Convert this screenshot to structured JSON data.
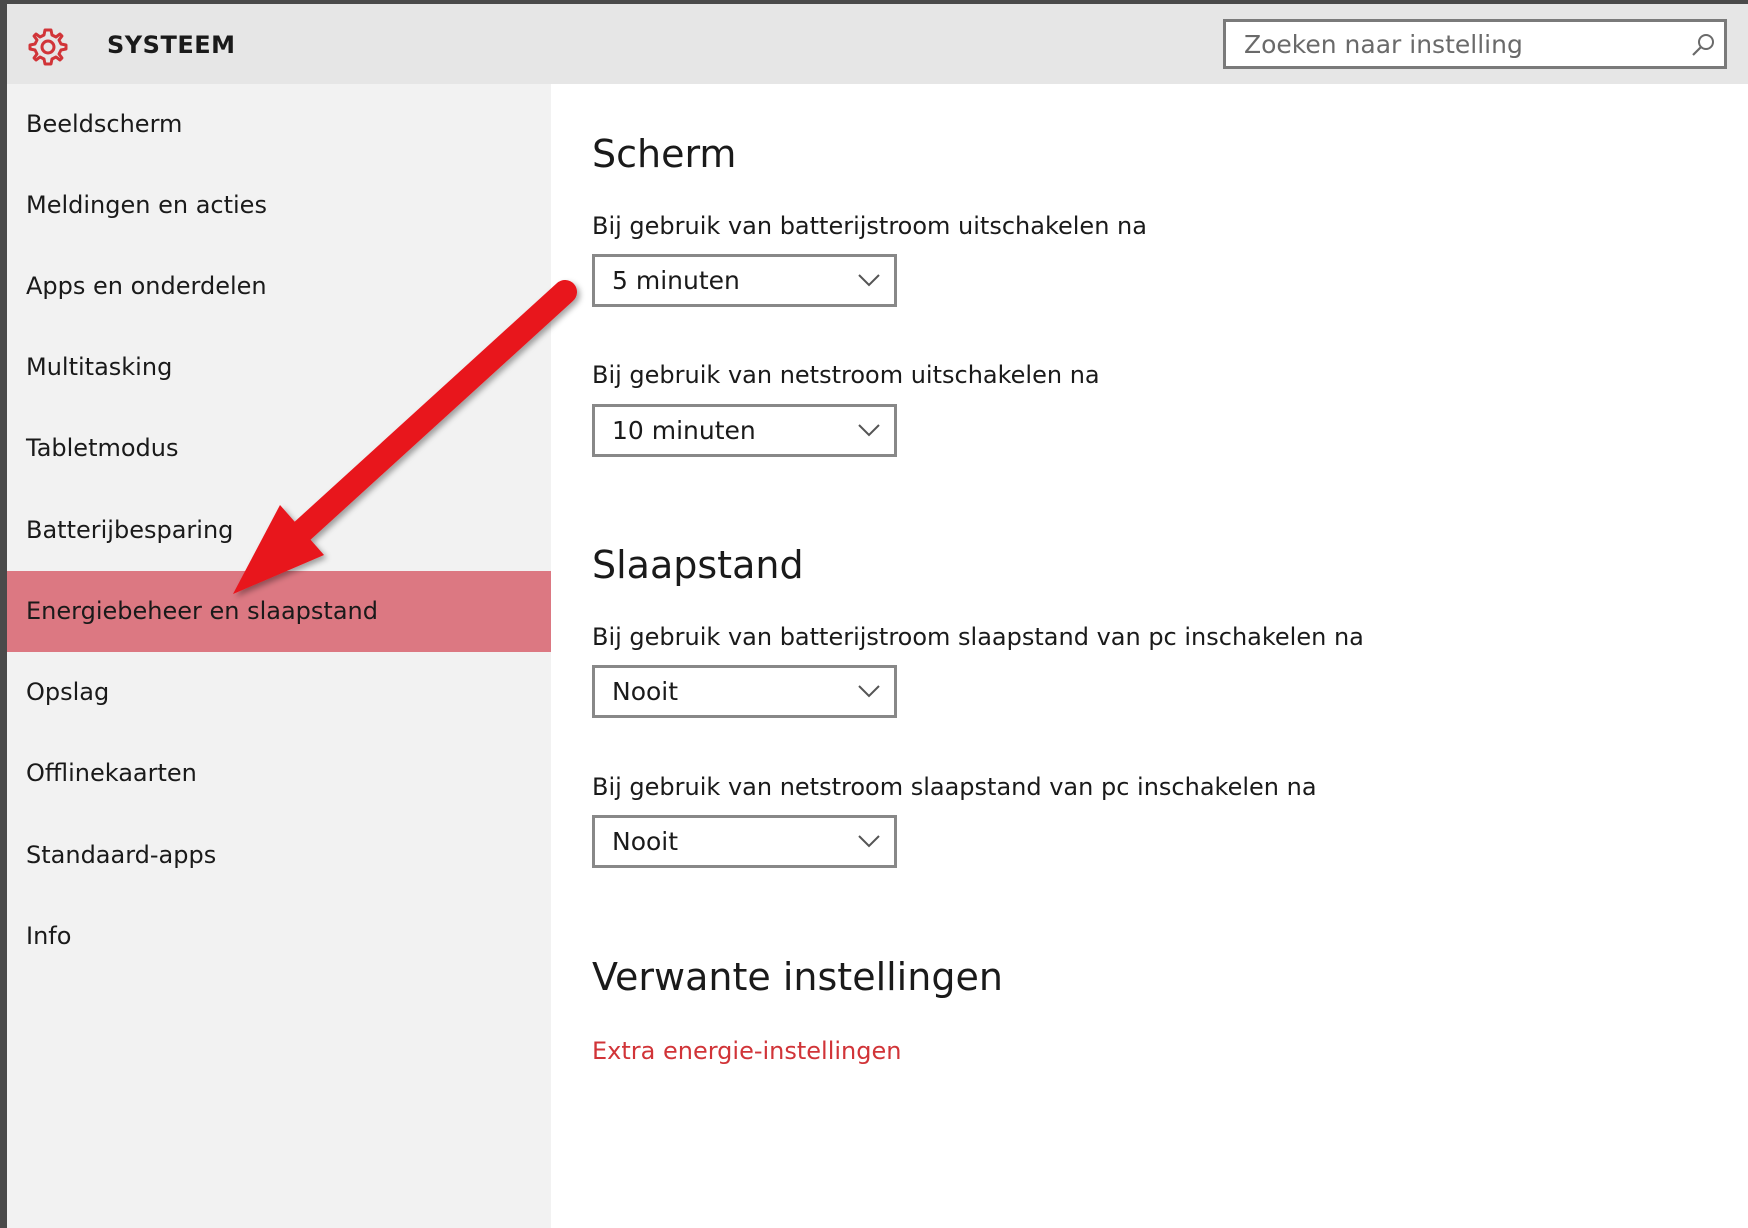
{
  "header": {
    "title": "SYSTEEM",
    "search_placeholder": "Zoeken naar instelling"
  },
  "sidebar": {
    "items": [
      {
        "label": "Beeldscherm"
      },
      {
        "label": "Meldingen en acties"
      },
      {
        "label": "Apps en onderdelen"
      },
      {
        "label": "Multitasking"
      },
      {
        "label": "Tabletmodus"
      },
      {
        "label": "Batterijbesparing"
      },
      {
        "label": "Energiebeheer en slaapstand"
      },
      {
        "label": "Opslag"
      },
      {
        "label": "Offlinekaarten"
      },
      {
        "label": "Standaard-apps"
      },
      {
        "label": "Info"
      }
    ],
    "selected_index": 6
  },
  "main": {
    "screen": {
      "heading": "Scherm",
      "battery_label": "Bij gebruik van batterijstroom uitschakelen na",
      "battery_value": "5 minuten",
      "plugged_label": "Bij gebruik van netstroom uitschakelen na",
      "plugged_value": "10 minuten"
    },
    "sleep": {
      "heading": "Slaapstand",
      "battery_label": "Bij gebruik van batterijstroom slaapstand van pc inschakelen na",
      "battery_value": "Nooit",
      "plugged_label": "Bij gebruik van netstroom slaapstand van pc inschakelen na",
      "plugged_value": "Nooit"
    },
    "related": {
      "heading": "Verwante instellingen",
      "link": "Extra energie-instellingen"
    }
  },
  "colors": {
    "accent": "#d13438",
    "selected_bg": "#dc7882",
    "annotation_arrow": "#e8131b"
  },
  "icons": {
    "app": "gear-icon",
    "search": "search-icon",
    "dropdown": "chevron-down-icon"
  }
}
